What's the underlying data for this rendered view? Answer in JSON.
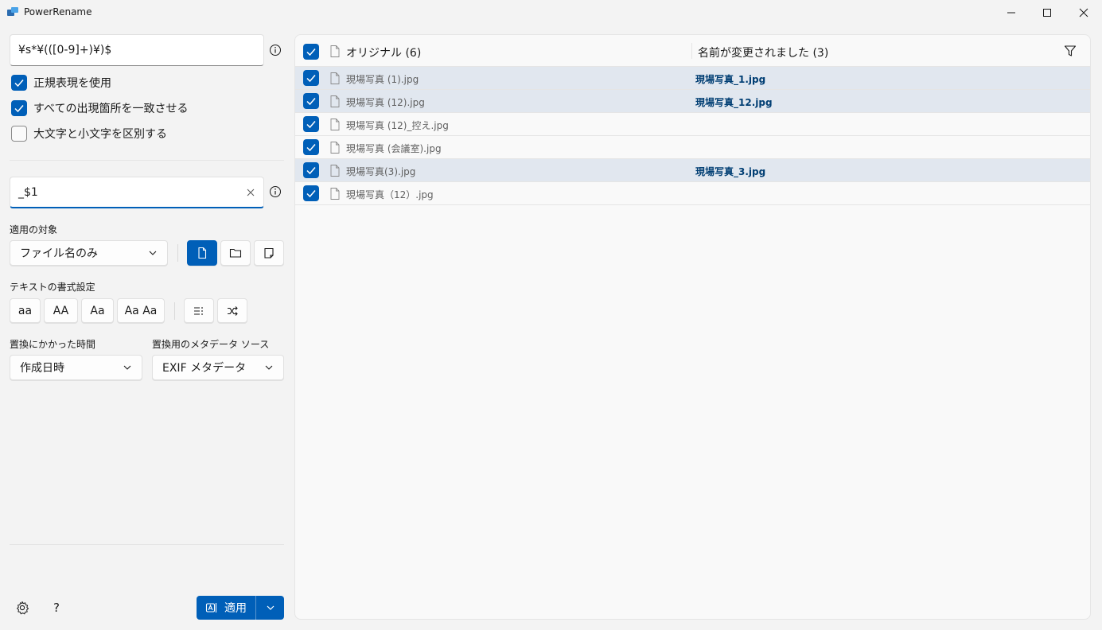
{
  "window": {
    "title": "PowerRename"
  },
  "search": {
    "value": "¥s*¥(([0-9]+)¥)$"
  },
  "options": [
    {
      "label": "正規表現を使用",
      "checked": true
    },
    {
      "label": "すべての出現箇所を一致させる",
      "checked": true
    },
    {
      "label": "大文字と小文字を区別する",
      "checked": false
    }
  ],
  "replace": {
    "value": "_$1"
  },
  "apply_to": {
    "label": "適用の対象",
    "selected": "ファイル名のみ"
  },
  "text_format": {
    "label": "テキストの書式設定",
    "buttons": [
      "aa",
      "AA",
      "Aa",
      "Aa Aa"
    ]
  },
  "time": {
    "label": "置換にかかった時間",
    "selected": "作成日時"
  },
  "metadata": {
    "label": "置換用のメタデータ ソース",
    "selected": "EXIF メタデータ"
  },
  "apply_button": {
    "label": "適用"
  },
  "help": {
    "label": "?"
  },
  "list": {
    "header_original": "オリジナル (6)",
    "header_renamed": "名前が変更されました (3)",
    "rows": [
      {
        "original": "現場写真 (1).jpg",
        "renamed": "現場写真_1.jpg",
        "selected": true
      },
      {
        "original": "現場写真 (12).jpg",
        "renamed": "現場写真_12.jpg",
        "selected": true
      },
      {
        "original": "現場写真 (12)_控え.jpg",
        "renamed": "",
        "selected": false
      },
      {
        "original": "現場写真 (会議室).jpg",
        "renamed": "",
        "selected": false
      },
      {
        "original": "現場写真(3).jpg",
        "renamed": "現場写真_3.jpg",
        "selected": true
      },
      {
        "original": "現場写真（12）.jpg",
        "renamed": "",
        "selected": false
      }
    ]
  },
  "colors": {
    "accent": "#005fb8",
    "selected_row": "#e1e7ef",
    "renamed_text": "#003e73"
  }
}
